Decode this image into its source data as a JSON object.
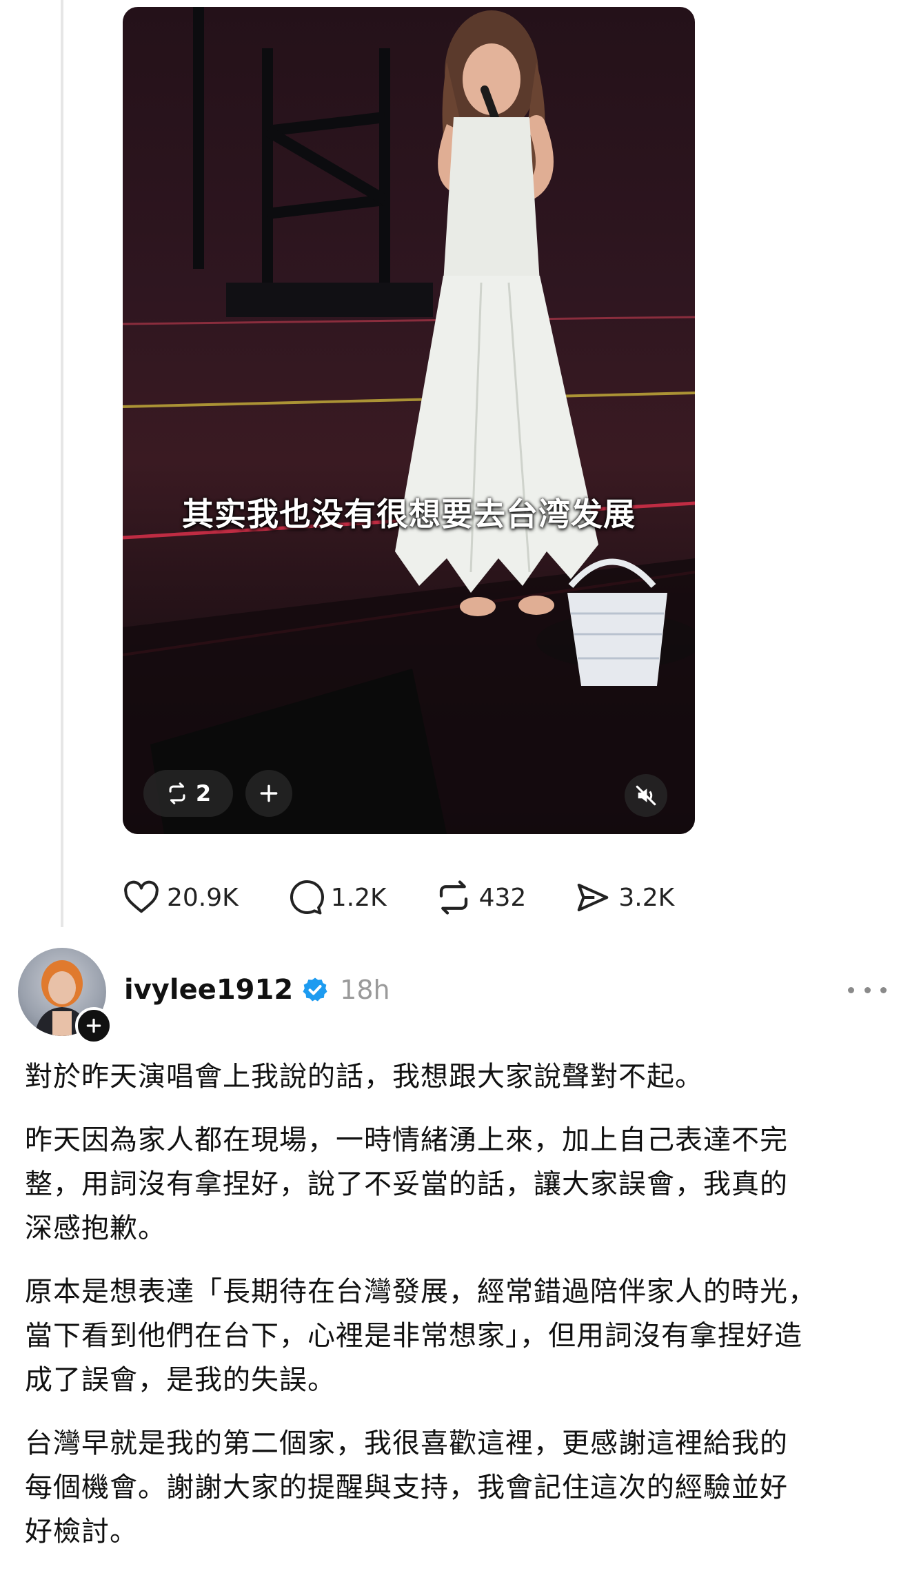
{
  "video": {
    "caption": "其实我也没有很想要去台湾发展",
    "repost_count": "2"
  },
  "actions": {
    "likes": "20.9K",
    "comments": "1.2K",
    "reposts": "432",
    "shares": "3.2K"
  },
  "post": {
    "username": "ivylee1912",
    "time": "18h",
    "paragraphs": [
      "對於昨天演唱會上我說的話，我想跟大家說聲對不起。",
      "昨天因為家人都在現場，一時情緒湧上來，加上自己表達不完\n整，用詞沒有拿捏好，說了不妥當的話，讓大家誤會，我真的\n深感抱歉。",
      "原本是想表達「長期待在台灣發展，經常錯過陪伴家人的時光，\n當下看到他們在台下，心裡是非常想家」，但用詞沒有拿捏好造\n成了誤會，是我的失誤。",
      "台灣早就是我的第二個家，我很喜歡這裡，更感謝這裡給我的\n每個機會。謝謝大家的提醒與支持，我會記住這次的經驗並好\n好檢討。"
    ]
  },
  "icons": {
    "verified_color": "#1d9bf0"
  }
}
